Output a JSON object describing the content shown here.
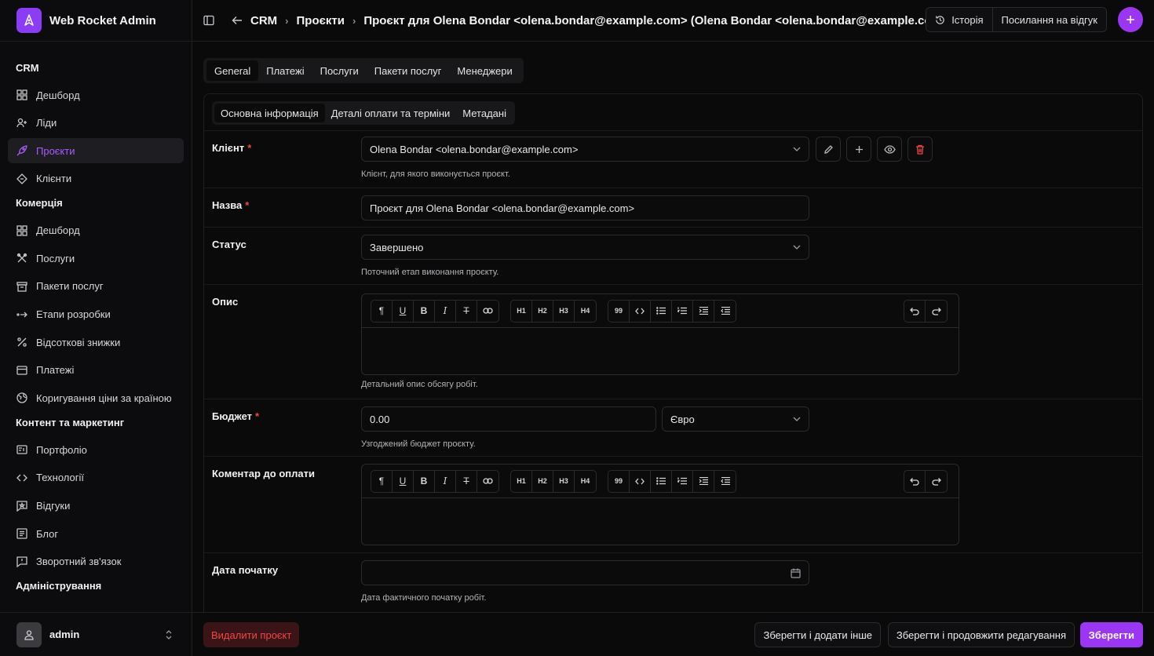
{
  "app": {
    "name": "Web Rocket Admin"
  },
  "sidebar": {
    "groups": [
      {
        "title": "CRM",
        "items": [
          {
            "label": "Дешборд",
            "icon": "dashboard-icon"
          },
          {
            "label": "Ліди",
            "icon": "users-plus-icon"
          },
          {
            "label": "Проєкти",
            "icon": "rocket-icon",
            "active": true
          },
          {
            "label": "Клієнти",
            "icon": "handshake-icon"
          }
        ]
      },
      {
        "title": "Комерція",
        "items": [
          {
            "label": "Дешборд",
            "icon": "dashboard-icon"
          },
          {
            "label": "Послуги",
            "icon": "tools-icon"
          },
          {
            "label": "Пакети послуг",
            "icon": "package-icon"
          },
          {
            "label": "Етапи розробки",
            "icon": "steps-icon"
          },
          {
            "label": "Відсоткові знижки",
            "icon": "percent-icon"
          },
          {
            "label": "Платежі",
            "icon": "credit-card-icon"
          },
          {
            "label": "Коригування ціни за країною",
            "icon": "globe-icon"
          }
        ]
      },
      {
        "title": "Контент та маркетинг",
        "items": [
          {
            "label": "Портфоліо",
            "icon": "portfolio-icon"
          },
          {
            "label": "Технології",
            "icon": "code-icon"
          },
          {
            "label": "Відгуки",
            "icon": "review-icon"
          },
          {
            "label": "Блог",
            "icon": "blog-icon"
          },
          {
            "label": "Зворотний зв'язок",
            "icon": "feedback-icon"
          }
        ]
      },
      {
        "title": "Адміністрування",
        "items": []
      }
    ],
    "user": {
      "name": "admin"
    }
  },
  "header": {
    "breadcrumbs": [
      "CRM",
      "Проєкти",
      "Проєкт для Olena Bondar <olena.bondar@example.com> (Olena Bondar <olena.bondar@example.com>)"
    ],
    "history_label": "Історія",
    "review_link_label": "Посилання на відгук"
  },
  "tabs": [
    "General",
    "Платежі",
    "Послуги",
    "Пакети послуг",
    "Менеджери"
  ],
  "subtabs": [
    "Основна інформація",
    "Деталі оплати та терміни",
    "Метадані"
  ],
  "form": {
    "client": {
      "label": "Клієнт",
      "value": "Olena Bondar <olena.bondar@example.com>",
      "help": "Клієнт, для якого виконується проєкт."
    },
    "name": {
      "label": "Назва",
      "value": "Проєкт для Olena Bondar <olena.bondar@example.com>"
    },
    "status": {
      "label": "Статус",
      "value": "Завершено",
      "help": "Поточний етап виконання проєкту."
    },
    "description": {
      "label": "Опис",
      "help": "Детальний опис обсягу робіт."
    },
    "budget": {
      "label": "Бюджет",
      "value": "0.00",
      "currency": "Євро",
      "help": "Узгоджений бюджет проєкту."
    },
    "payment_comment": {
      "label": "Коментар до оплати"
    },
    "start_date": {
      "label": "Дата початку",
      "value": "",
      "help": "Дата фактичного початку робіт."
    }
  },
  "toolbar": {
    "h1": "H1",
    "h2": "H2",
    "h3": "H3",
    "h4": "H4",
    "quote": "99"
  },
  "footer": {
    "delete_label": "Видалити проєкт",
    "save_add_label": "Зберегти і додати інше",
    "save_continue_label": "Зберегти і продовжити редагування",
    "save_label": "Зберегти"
  },
  "colors": {
    "accent": "#9b36f5",
    "danger": "#ef4444"
  }
}
